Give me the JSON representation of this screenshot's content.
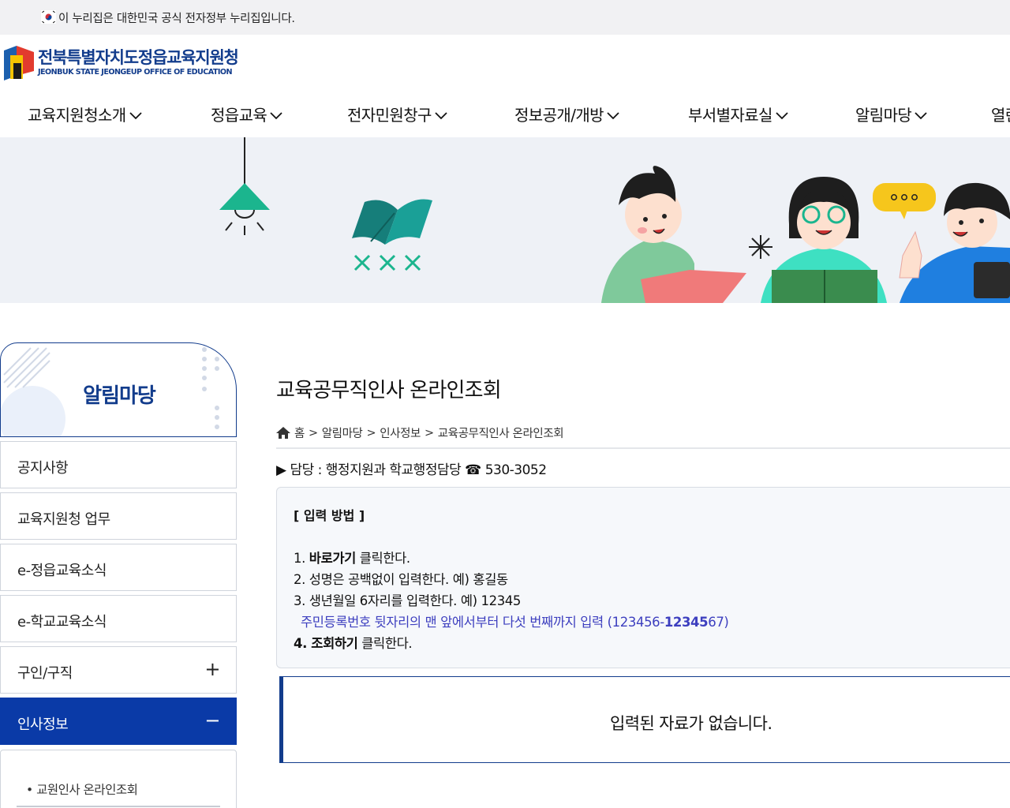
{
  "gov_banner": {
    "text": "이 누리집은 대한민국 공식 전자정부 누리집입니다."
  },
  "logo": {
    "title": "전북특별자치도정읍교육지원청",
    "subtitle": "JEONBUK STATE JEONGEUP OFFICE OF EDUCATION"
  },
  "nav": {
    "items": [
      {
        "label": "교육지원청소개"
      },
      {
        "label": "정읍교육"
      },
      {
        "label": "전자민원창구"
      },
      {
        "label": "정보공개/개방"
      },
      {
        "label": "부서별자료실"
      },
      {
        "label": "알림마당"
      },
      {
        "label": "열린"
      }
    ]
  },
  "sidebar": {
    "title": "알림마당",
    "items": [
      {
        "label": "공지사항",
        "sign": ""
      },
      {
        "label": "교육지원청 업무",
        "sign": ""
      },
      {
        "label": "e-정읍교육소식",
        "sign": ""
      },
      {
        "label": "e-학교교육소식",
        "sign": ""
      },
      {
        "label": "구인/구직",
        "sign": "+"
      },
      {
        "label": "인사정보",
        "sign": "−"
      }
    ],
    "sub_items": [
      {
        "label": "교원인사 온라인조회"
      }
    ]
  },
  "content": {
    "title": "교육공무직인사 온라인조회",
    "breadcrumb": [
      "홈",
      "알림마당",
      "인사정보",
      "교육공무직인사 온라인조회"
    ],
    "breadcrumb_sep": ">",
    "contact": "▶ 담당 : 행정지원과 학교행정담당 ☎ 530-3052",
    "guide": {
      "heading": "[ 입력 방법 ]",
      "line1_prefix": "1. ",
      "line1_bold": "바로가기",
      "line1_suffix": " 클릭한다.",
      "line2": "2. 성명은 공백없이 입력한다. 예) 홍길동",
      "line3": "3. 생년월일 6자리를 입력한다. 예) 12345",
      "note_prefix": "주민등록번호 뒷자리의 맨 앞에서부터 다섯 번째까지 입력 (123456-",
      "note_bold": "12345",
      "note_suffix": "67)",
      "line4_bold": "4. 조회하기",
      "line4_suffix": " 클릭한다."
    },
    "result_text": "입력된 자료가 없습니다."
  },
  "colors": {
    "brand_navy": "#123c8c",
    "active_blue": "#0a3aa7",
    "note_purple": "#3d3fbf",
    "hero_bg": "#eef1f6"
  }
}
